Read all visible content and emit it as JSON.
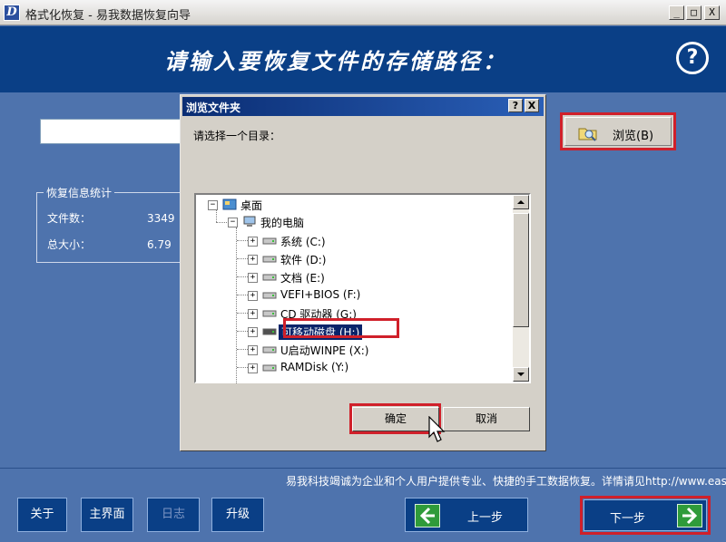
{
  "window": {
    "title": "格式化恢复 - 易我数据恢复向导",
    "app_icon_letter": "D",
    "controls": {
      "minimize": "_",
      "maximize": "□",
      "close": "X"
    }
  },
  "header": {
    "title": "请输入要恢复文件的存储路径：",
    "help": "?"
  },
  "path_input": {
    "value": ""
  },
  "browse_button": {
    "label": "浏览(B)"
  },
  "stats": {
    "legend": "恢复信息统计",
    "files_label": "文件数：",
    "files_value": "3349",
    "size_label": "总大小：",
    "size_value": "6.79"
  },
  "ticker": "易我科技竭诚为企业和个人用户提供专业、快捷的手工数据恢复。详情请见http://www.ease",
  "footer": {
    "about": "关于",
    "main": "主界面",
    "log": "日志",
    "upgrade": "升级",
    "prev": "上一步",
    "next": "下一步"
  },
  "dialog": {
    "title": "浏览文件夹",
    "help": "?",
    "close": "X",
    "prompt": "请选择一个目录：",
    "tree": {
      "desktop": "桌面",
      "computer": "我的电脑",
      "drives": [
        {
          "label": "系统 (C:)"
        },
        {
          "label": "软件 (D:)"
        },
        {
          "label": "文档 (E:)"
        },
        {
          "label": "VEFI+BIOS (F:)"
        },
        {
          "label": "CD 驱动器 (G:)"
        },
        {
          "label": "可移动磁盘 (H:)"
        },
        {
          "label": "U启动WINPE (X:)"
        },
        {
          "label": "RAMDisk (Y:)"
        }
      ],
      "selected_index": 5
    },
    "ok": "确定",
    "cancel": "取消"
  },
  "colors": {
    "window_bg": "#4e73ad",
    "header_bg": "#0a3f86",
    "dialog_title": "#0a2d73",
    "highlight": "#d0202a",
    "arrow_green": "#2f9b3a"
  },
  "icons": {
    "browse": "folder-search-icon",
    "desktop": "desktop-icon",
    "computer": "computer-icon",
    "drive": "drive-icon",
    "prev": "arrow-left-icon",
    "next": "arrow-right-icon",
    "cursor": "mouse-pointer-icon"
  }
}
